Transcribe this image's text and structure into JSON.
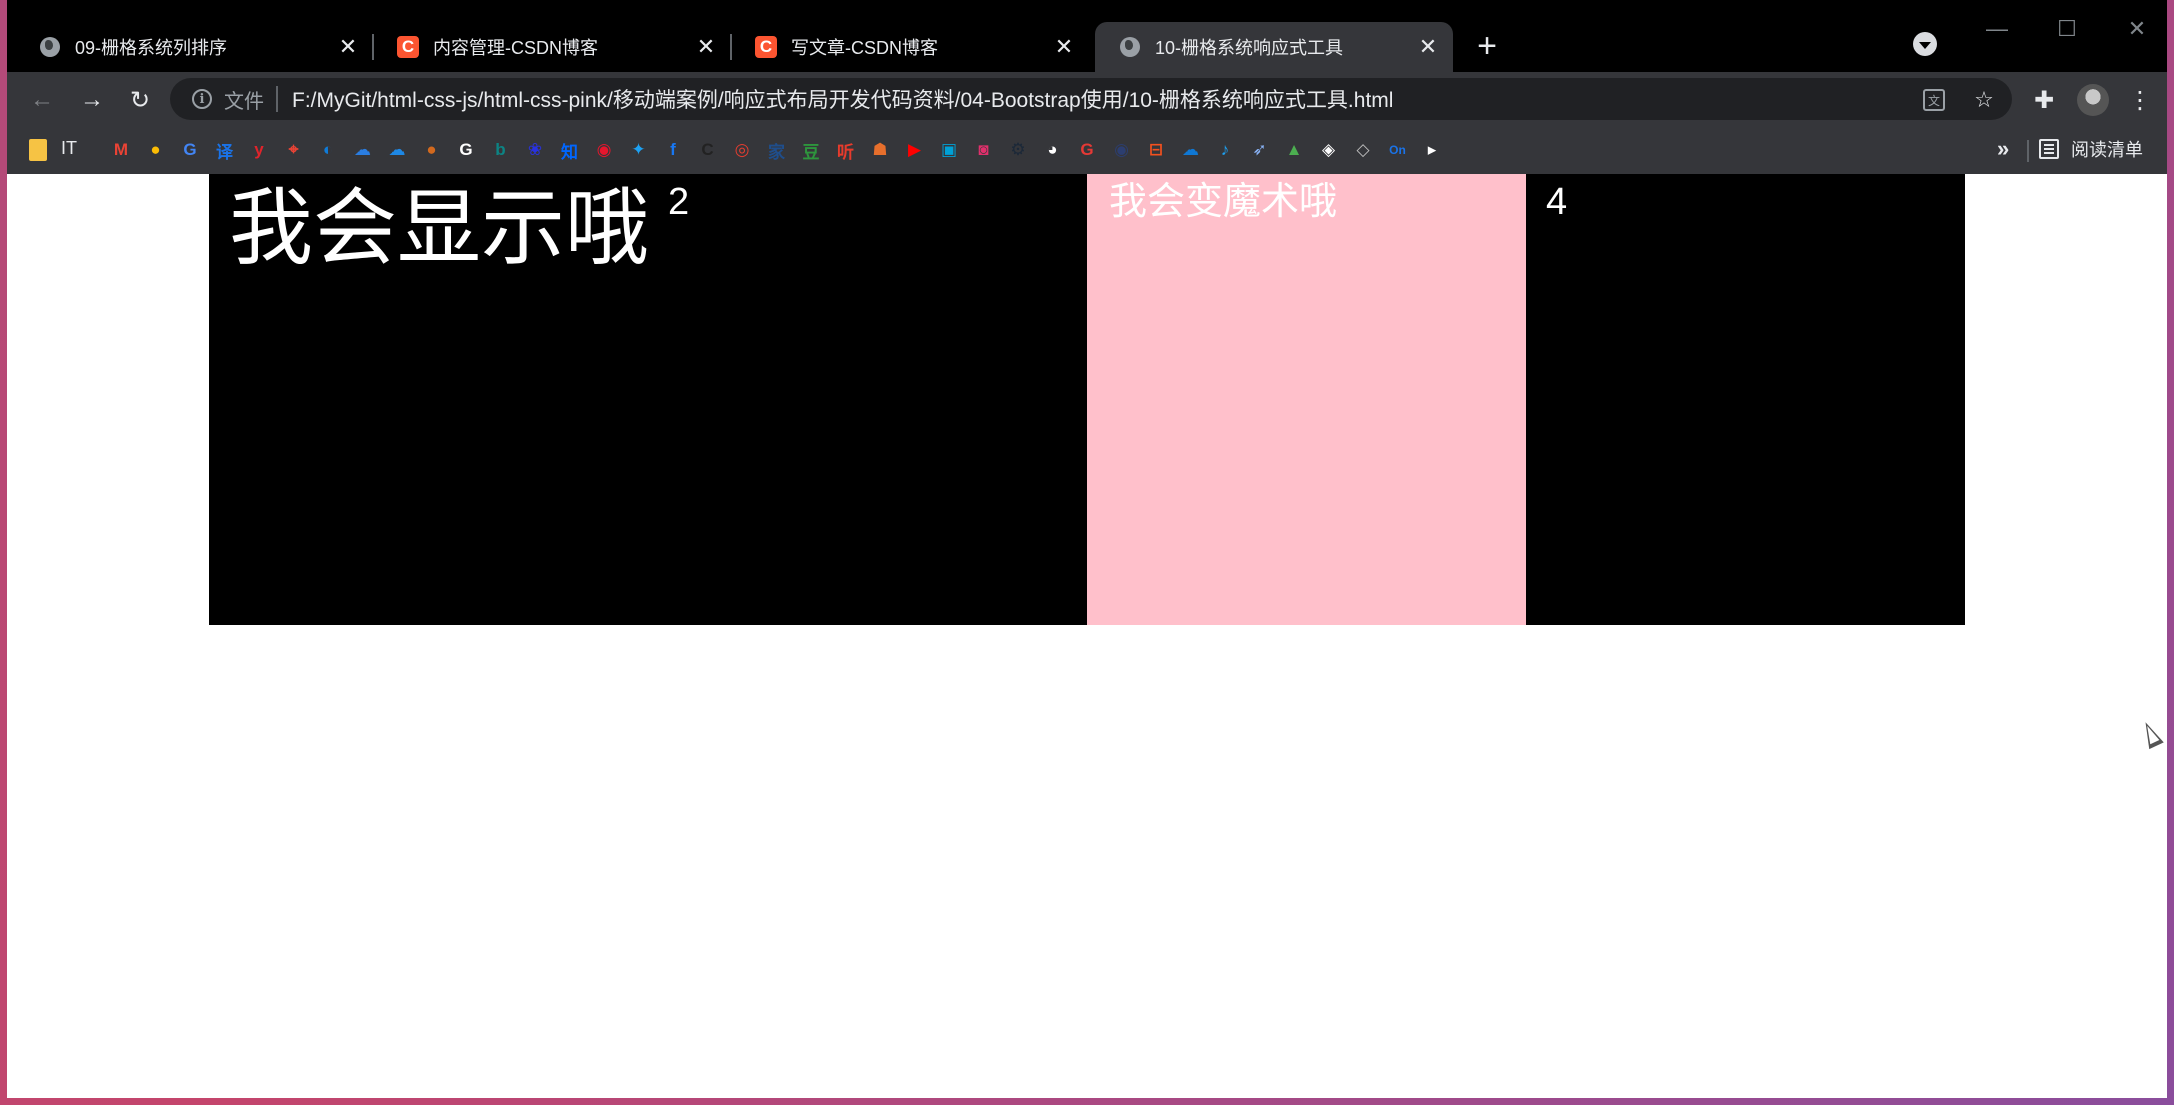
{
  "tabs": [
    {
      "title": "09-栅格系统列排序",
      "favicon": "globe-icon",
      "active": false
    },
    {
      "title": "内容管理-CSDN博客",
      "favicon": "csdn-icon",
      "favicon_letter": "C",
      "active": false
    },
    {
      "title": "写文章-CSDN博客",
      "favicon": "csdn-icon",
      "favicon_letter": "C",
      "active": false
    },
    {
      "title": "10-栅格系统响应式工具",
      "favicon": "globe-icon",
      "active": true
    }
  ],
  "tab_close_glyph": "✕",
  "new_tab_glyph": "+",
  "window_controls": {
    "minimize": "—",
    "maximize": "☐",
    "close": "✕"
  },
  "toolbar": {
    "back_glyph": "←",
    "forward_glyph": "→",
    "reload_glyph": "↻",
    "info_glyph": "i",
    "chip_label": "文件",
    "url": "F:/MyGit/html-css-js/html-css-pink/移动端案例/响应式布局开发代码资料/04-Bootstrap使用/10-栅格系统响应式工具.html",
    "translate_glyph": "文",
    "star_glyph": "☆",
    "extensions_glyph": "✚",
    "menu_glyph": "⋮"
  },
  "bookmarks": {
    "folder_label": "IT",
    "icons": [
      {
        "name": "gmail-icon",
        "color": "#ea4335",
        "glyph": "M"
      },
      {
        "name": "chrome-icon",
        "color": "#fbbc05",
        "glyph": "●"
      },
      {
        "name": "translate-bm-icon",
        "color": "#4285f4",
        "glyph": "G"
      },
      {
        "name": "youdao-icon",
        "color": "#1a73e8",
        "glyph": "译"
      },
      {
        "name": "y-icon",
        "color": "#e0242b",
        "glyph": "y"
      },
      {
        "name": "maps-icon",
        "color": "#ea4335",
        "glyph": "⌖"
      },
      {
        "name": "edge-icon",
        "color": "#0f7bd8",
        "glyph": "◐"
      },
      {
        "name": "baidu-cloud-icon",
        "color": "#2a7de1",
        "glyph": "☁"
      },
      {
        "name": "cloud-icon",
        "color": "#1e88e5",
        "glyph": "☁"
      },
      {
        "name": "acorn-icon",
        "color": "#d2691e",
        "glyph": "●"
      },
      {
        "name": "google-icon",
        "color": "#ffffff",
        "glyph": "G"
      },
      {
        "name": "bing-icon",
        "color": "#0c8484",
        "glyph": "b"
      },
      {
        "name": "baidu-icon",
        "color": "#2932e1",
        "glyph": "❀"
      },
      {
        "name": "zhihu-icon",
        "color": "#0066ff",
        "glyph": "知"
      },
      {
        "name": "weibo-icon",
        "color": "#e6162d",
        "glyph": "◉"
      },
      {
        "name": "twitter-icon",
        "color": "#1da1f2",
        "glyph": "✦"
      },
      {
        "name": "facebook-icon",
        "color": "#1877f2",
        "glyph": "f"
      },
      {
        "name": "csdn-bm-icon",
        "color": "#222222",
        "glyph": "C"
      },
      {
        "name": "opera-icon",
        "color": "#e43d30",
        "glyph": "◎"
      },
      {
        "name": "jia-icon",
        "color": "#1f4e8c",
        "glyph": "家"
      },
      {
        "name": "douban-icon",
        "color": "#2e963d",
        "glyph": "豆"
      },
      {
        "name": "ting-icon",
        "color": "#e73b2c",
        "glyph": "听"
      },
      {
        "name": "game-icon",
        "color": "#e76f2c",
        "glyph": "☗"
      },
      {
        "name": "youtube-icon",
        "color": "#ff0000",
        "glyph": "▶"
      },
      {
        "name": "bilibili-icon",
        "color": "#00a1d6",
        "glyph": "▣"
      },
      {
        "name": "instagram-icon",
        "color": "#e1306c",
        "glyph": "◙"
      },
      {
        "name": "steam-icon",
        "color": "#1b2838",
        "glyph": "⚙"
      },
      {
        "name": "github-icon",
        "color": "#ffffff",
        "glyph": "◕"
      },
      {
        "name": "g-red-icon",
        "color": "#e53935",
        "glyph": "G"
      },
      {
        "name": "eye-icon",
        "color": "#2c3e70",
        "glyph": "◉"
      },
      {
        "name": "code-icon",
        "color": "#f4511e",
        "glyph": "⊟"
      },
      {
        "name": "onedrive-icon",
        "color": "#0f78d4",
        "glyph": "☁"
      },
      {
        "name": "bird-icon",
        "color": "#1da1f2",
        "glyph": "♪"
      },
      {
        "name": "rocket-icon",
        "color": "#8ab4f8",
        "glyph": "➶"
      },
      {
        "name": "cap-icon",
        "color": "#4caf50",
        "glyph": "▲"
      },
      {
        "name": "codepen-icon",
        "color": "#ffffff",
        "glyph": "◈"
      },
      {
        "name": "box-icon",
        "color": "#bdbdbd",
        "glyph": "◇"
      },
      {
        "name": "on-icon",
        "color": "#1a73e8",
        "glyph": "On"
      },
      {
        "name": "play-icon",
        "color": "#ffffff",
        "glyph": "▸"
      }
    ],
    "more_glyph": "»",
    "reading_list_label": "阅读清单"
  },
  "page": {
    "col1_text": "我会显示哦",
    "col2_text": "2",
    "col3_text": "我会变魔术哦",
    "col4_text": "4",
    "colors": {
      "dark": "#000000",
      "pink": "#ffc0cb",
      "text": "#ffffff"
    }
  }
}
